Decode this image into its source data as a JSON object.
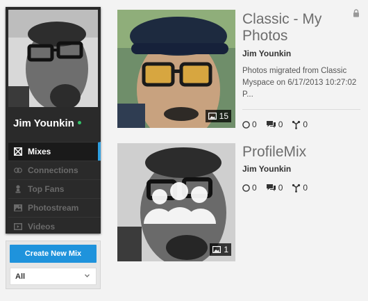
{
  "profile": {
    "name": "Jim Younkin"
  },
  "nav": {
    "items": [
      {
        "label": "Mixes",
        "icon": "mixes-icon",
        "active": true
      },
      {
        "label": "Connections",
        "icon": "connections-icon"
      },
      {
        "label": "Top Fans",
        "icon": "top-fans-icon"
      },
      {
        "label": "Photostream",
        "icon": "photostream-icon"
      },
      {
        "label": "Videos",
        "icon": "videos-icon"
      }
    ]
  },
  "actions": {
    "create_label": "Create New Mix",
    "filter_value": "All"
  },
  "mixes": [
    {
      "title": "Classic - My Photos",
      "owner": "Jim Younkin",
      "description": "Photos migrated from Classic Myspace on 6/17/2013 10:27:02 P...",
      "photo_count": "15",
      "stats": {
        "plays": "0",
        "comments": "0",
        "shares": "0"
      },
      "locked": true
    },
    {
      "title": "ProfileMix",
      "owner": "Jim Younkin",
      "photo_count": "1",
      "stats": {
        "plays": "0",
        "comments": "0",
        "shares": "0"
      }
    }
  ],
  "colors": {
    "accent": "#1f93dc",
    "online": "#34c46a",
    "sidebar_bg": "#2a2a2a"
  }
}
